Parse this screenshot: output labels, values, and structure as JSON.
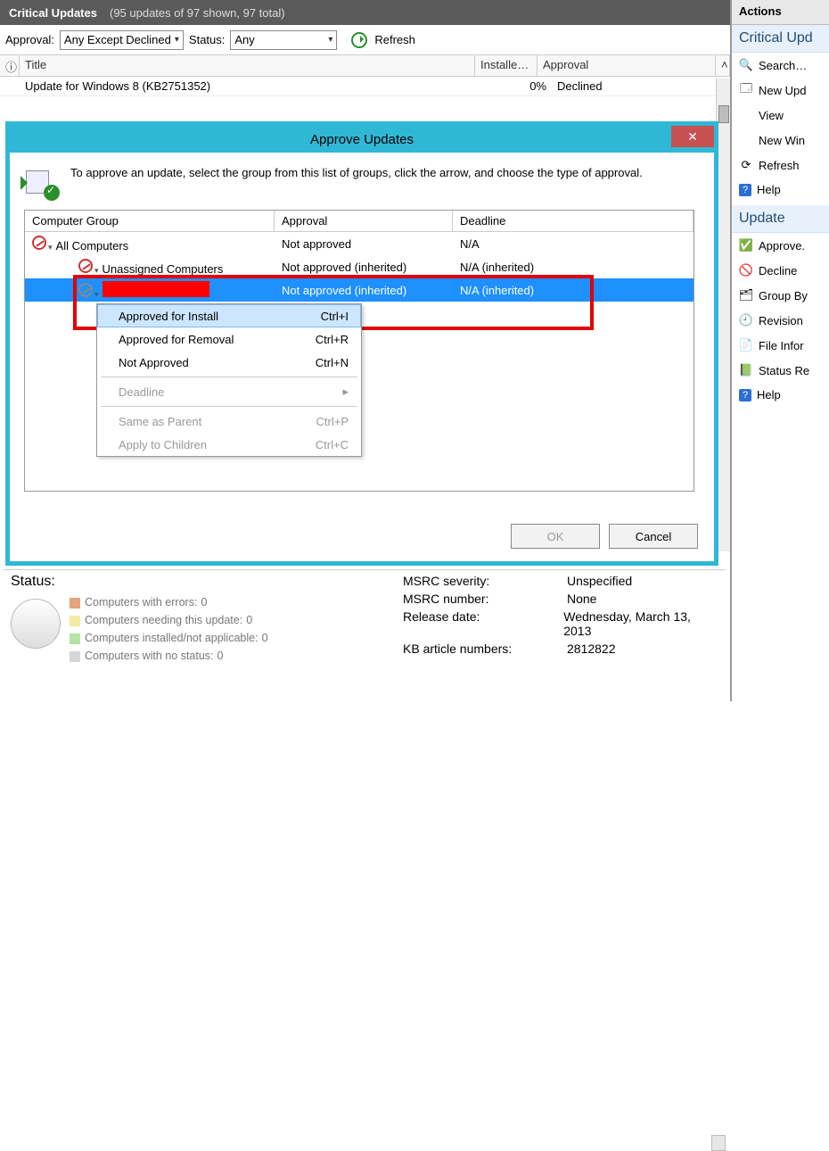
{
  "header": {
    "title": "Critical Updates",
    "subtitle": "(95 updates of 97 shown, 97 total)"
  },
  "filter": {
    "approval_label": "Approval:",
    "approval_value": "Any Except Declined",
    "status_label": "Status:",
    "status_value": "Any",
    "refresh": "Refresh"
  },
  "columns": {
    "icon": "ⓘ",
    "title": "Title",
    "installed": "Installe…",
    "approval": "Approval"
  },
  "rows": [
    {
      "title": "Update for Windows 8 (KB2751352)",
      "installed": "0%",
      "approval": "Declined"
    }
  ],
  "dialog": {
    "title": "Approve Updates",
    "instruction": "To approve an update, select the group from this list of groups, click the arrow, and choose the type of approval.",
    "headers": {
      "group": "Computer Group",
      "approval": "Approval",
      "deadline": "Deadline"
    },
    "groups": [
      {
        "name": "All Computers",
        "approval": "Not approved",
        "deadline": "N/A",
        "indent": 0
      },
      {
        "name": "Unassigned Computers",
        "approval": "Not approved (inherited)",
        "deadline": "N/A (inherited)",
        "indent": 1
      },
      {
        "name": "",
        "approval": "Not approved (inherited)",
        "deadline": "N/A (inherited)",
        "indent": 1,
        "selected": true,
        "redacted": true
      }
    ],
    "menu": [
      {
        "label": "Approved for Install",
        "shortcut": "Ctrl+I",
        "hover": true
      },
      {
        "label": "Approved for Removal",
        "shortcut": "Ctrl+R"
      },
      {
        "label": "Not Approved",
        "shortcut": "Ctrl+N"
      },
      {
        "label": "Deadline",
        "shortcut": "▸",
        "disabled": true
      },
      {
        "label": "Same as Parent",
        "shortcut": "Ctrl+P",
        "disabled": true
      },
      {
        "label": "Apply to Children",
        "shortcut": "Ctrl+C",
        "disabled": true
      }
    ],
    "ok": "OK",
    "cancel": "Cancel"
  },
  "status": {
    "heading": "Status:",
    "items": [
      {
        "label": "Computers with errors:",
        "count": "0"
      },
      {
        "label": "Computers needing this update:",
        "count": "0"
      },
      {
        "label": "Computers installed/not applicable:",
        "count": "0"
      },
      {
        "label": "Computers with no status:",
        "count": "0"
      }
    ],
    "props": {
      "msrc_sev_l": "MSRC severity:",
      "msrc_sev_v": "Unspecified",
      "msrc_num_l": "MSRC number:",
      "msrc_num_v": "None",
      "rel_l": "Release date:",
      "rel_v": "Wednesday, March 13, 2013",
      "kb_l": "KB article numbers:",
      "kb_v": "2812822"
    }
  },
  "actions": {
    "title": "Actions",
    "group1": "Critical Upd",
    "group2": "Update",
    "list1": [
      {
        "label": "Search…",
        "icon": "search"
      },
      {
        "label": "New Upd",
        "icon": "new"
      },
      {
        "label": "View",
        "icon": ""
      },
      {
        "label": "New Win",
        "icon": ""
      },
      {
        "label": "Refresh",
        "icon": "refresh"
      },
      {
        "label": "Help",
        "icon": "help"
      }
    ],
    "list2": [
      {
        "label": "Approve.",
        "icon": "approve"
      },
      {
        "label": "Decline",
        "icon": "decline"
      },
      {
        "label": "Group By",
        "icon": "group"
      },
      {
        "label": "Revision",
        "icon": "rev"
      },
      {
        "label": "File Infor",
        "icon": "file"
      },
      {
        "label": "Status Re",
        "icon": "status"
      },
      {
        "label": "Help",
        "icon": "help"
      }
    ]
  }
}
